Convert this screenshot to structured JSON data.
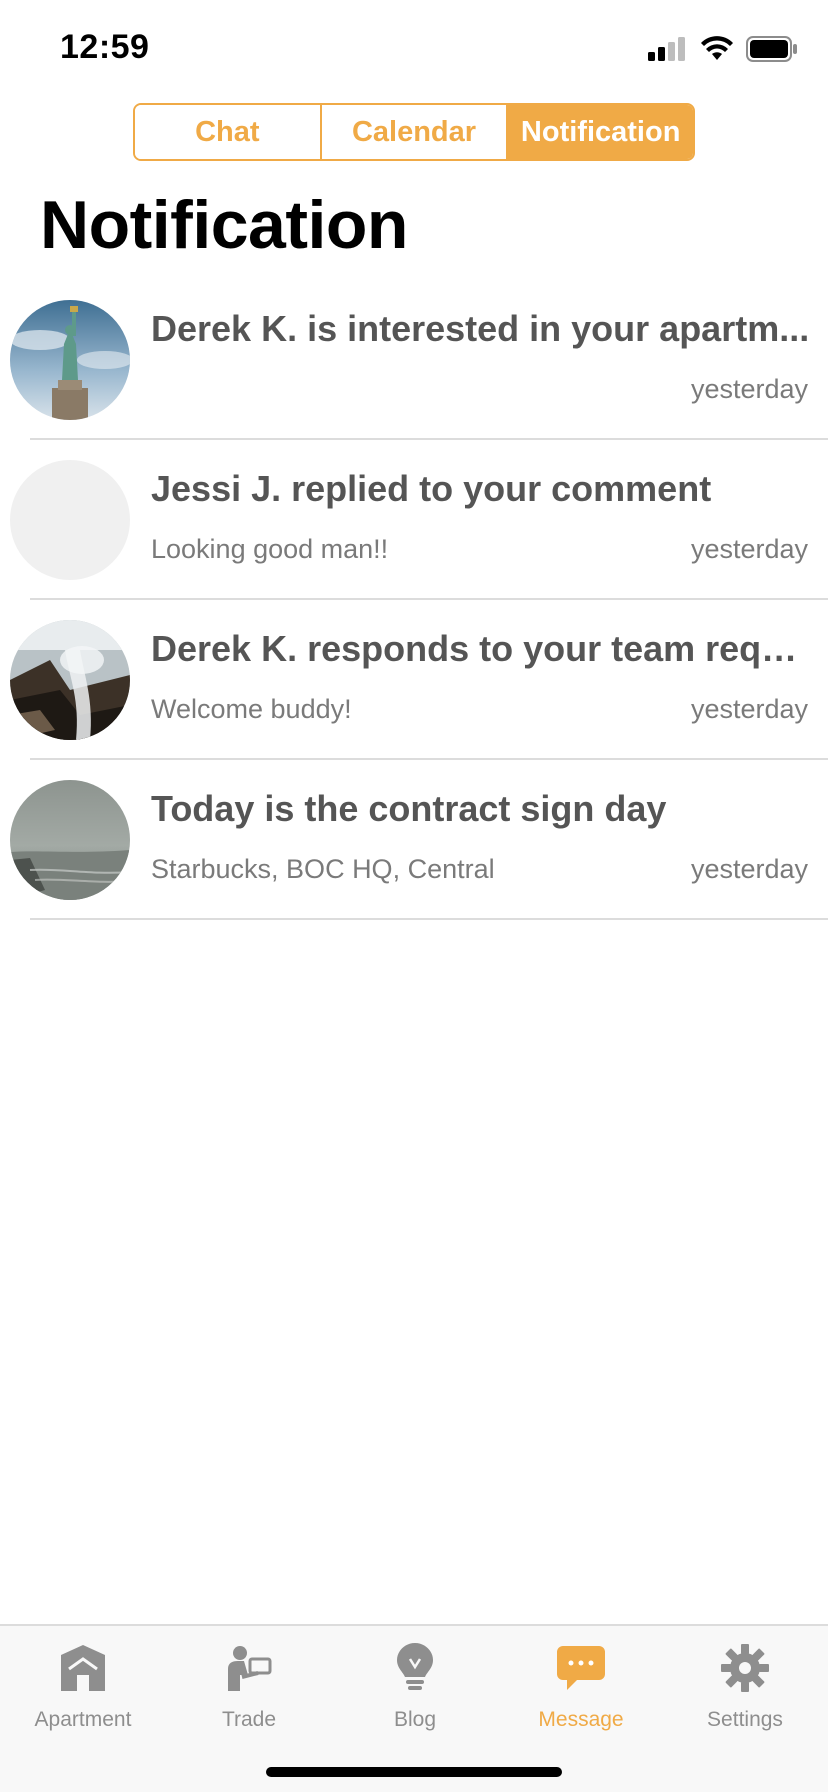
{
  "status_bar": {
    "time": "12:59"
  },
  "segments": [
    {
      "label": "Chat",
      "active": false
    },
    {
      "label": "Calendar",
      "active": false
    },
    {
      "label": "Notification",
      "active": true
    }
  ],
  "page": {
    "title": "Notification"
  },
  "notifications": [
    {
      "title": "Derek K. is interested in your apartm...",
      "subtitle": "",
      "time": "yesterday",
      "avatar": "statue-of-liberty-photo"
    },
    {
      "title": "Jessi J. replied to your comment",
      "subtitle": "Looking good man!!",
      "time": "yesterday",
      "avatar": "placeholder-avatar"
    },
    {
      "title": "Derek K. responds to your team requ...",
      "subtitle": "Welcome buddy!",
      "time": "yesterday",
      "avatar": "waterfall-photo"
    },
    {
      "title": "Today is the contract sign day",
      "subtitle": "Starbucks, BOC HQ, Central",
      "time": "yesterday",
      "avatar": "foggy-coast-photo"
    }
  ],
  "tab_bar": {
    "items": [
      {
        "label": "Apartment",
        "icon": "house-icon",
        "active": false
      },
      {
        "label": "Trade",
        "icon": "trade-icon",
        "active": false
      },
      {
        "label": "Blog",
        "icon": "lightbulb-icon",
        "active": false
      },
      {
        "label": "Message",
        "icon": "message-bubble-icon",
        "active": true
      },
      {
        "label": "Settings",
        "icon": "gear-icon",
        "active": false
      }
    ]
  },
  "colors": {
    "accent": "#F0AA46",
    "inactive": "#8e8e8e",
    "text_secondary": "#7a7a7a"
  }
}
